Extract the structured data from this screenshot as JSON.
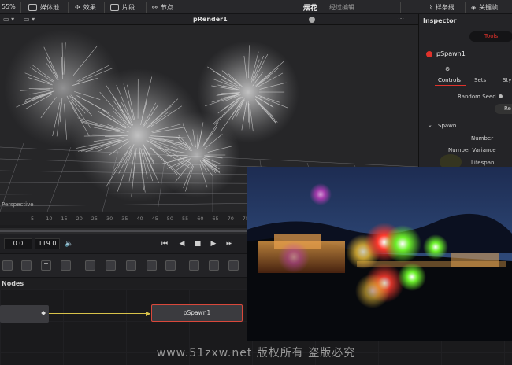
{
  "topbar": {
    "zoom": "55%",
    "items": [
      "媒体池",
      "效果",
      "片段",
      "节点"
    ],
    "page_title": "烟花",
    "page_subtitle": "经过编辑",
    "right_items": [
      "样条线",
      "关键帧"
    ]
  },
  "viewer": {
    "title": "pRender1",
    "view_label": "Perspective"
  },
  "ruler": {
    "ticks": [
      "5",
      "10",
      "15",
      "20",
      "25",
      "30",
      "35",
      "40",
      "45",
      "50",
      "55",
      "60",
      "65",
      "70",
      "75"
    ]
  },
  "transport": {
    "start": "0.0",
    "end": "119.0"
  },
  "inspector": {
    "title": "Inspector",
    "tab_tools": "Tools",
    "node_name": "pSpawn1",
    "subtabs": [
      "Controls",
      "Sets",
      "Style"
    ],
    "random_seed_label": "Random Seed",
    "reseed_button": "Re",
    "section": "Spawn",
    "params": [
      "Number",
      "Number Variance",
      "Lifespan"
    ]
  },
  "nodes": {
    "label": "Nodes",
    "node_pspawn": "pSpawn1"
  },
  "watermark": "www.51zxw.net 版权所有 盗版必究",
  "colors": {
    "accent_red": "#e0322b",
    "node_selected_border": "#d9483b",
    "link_yellow": "#d8c24a"
  }
}
